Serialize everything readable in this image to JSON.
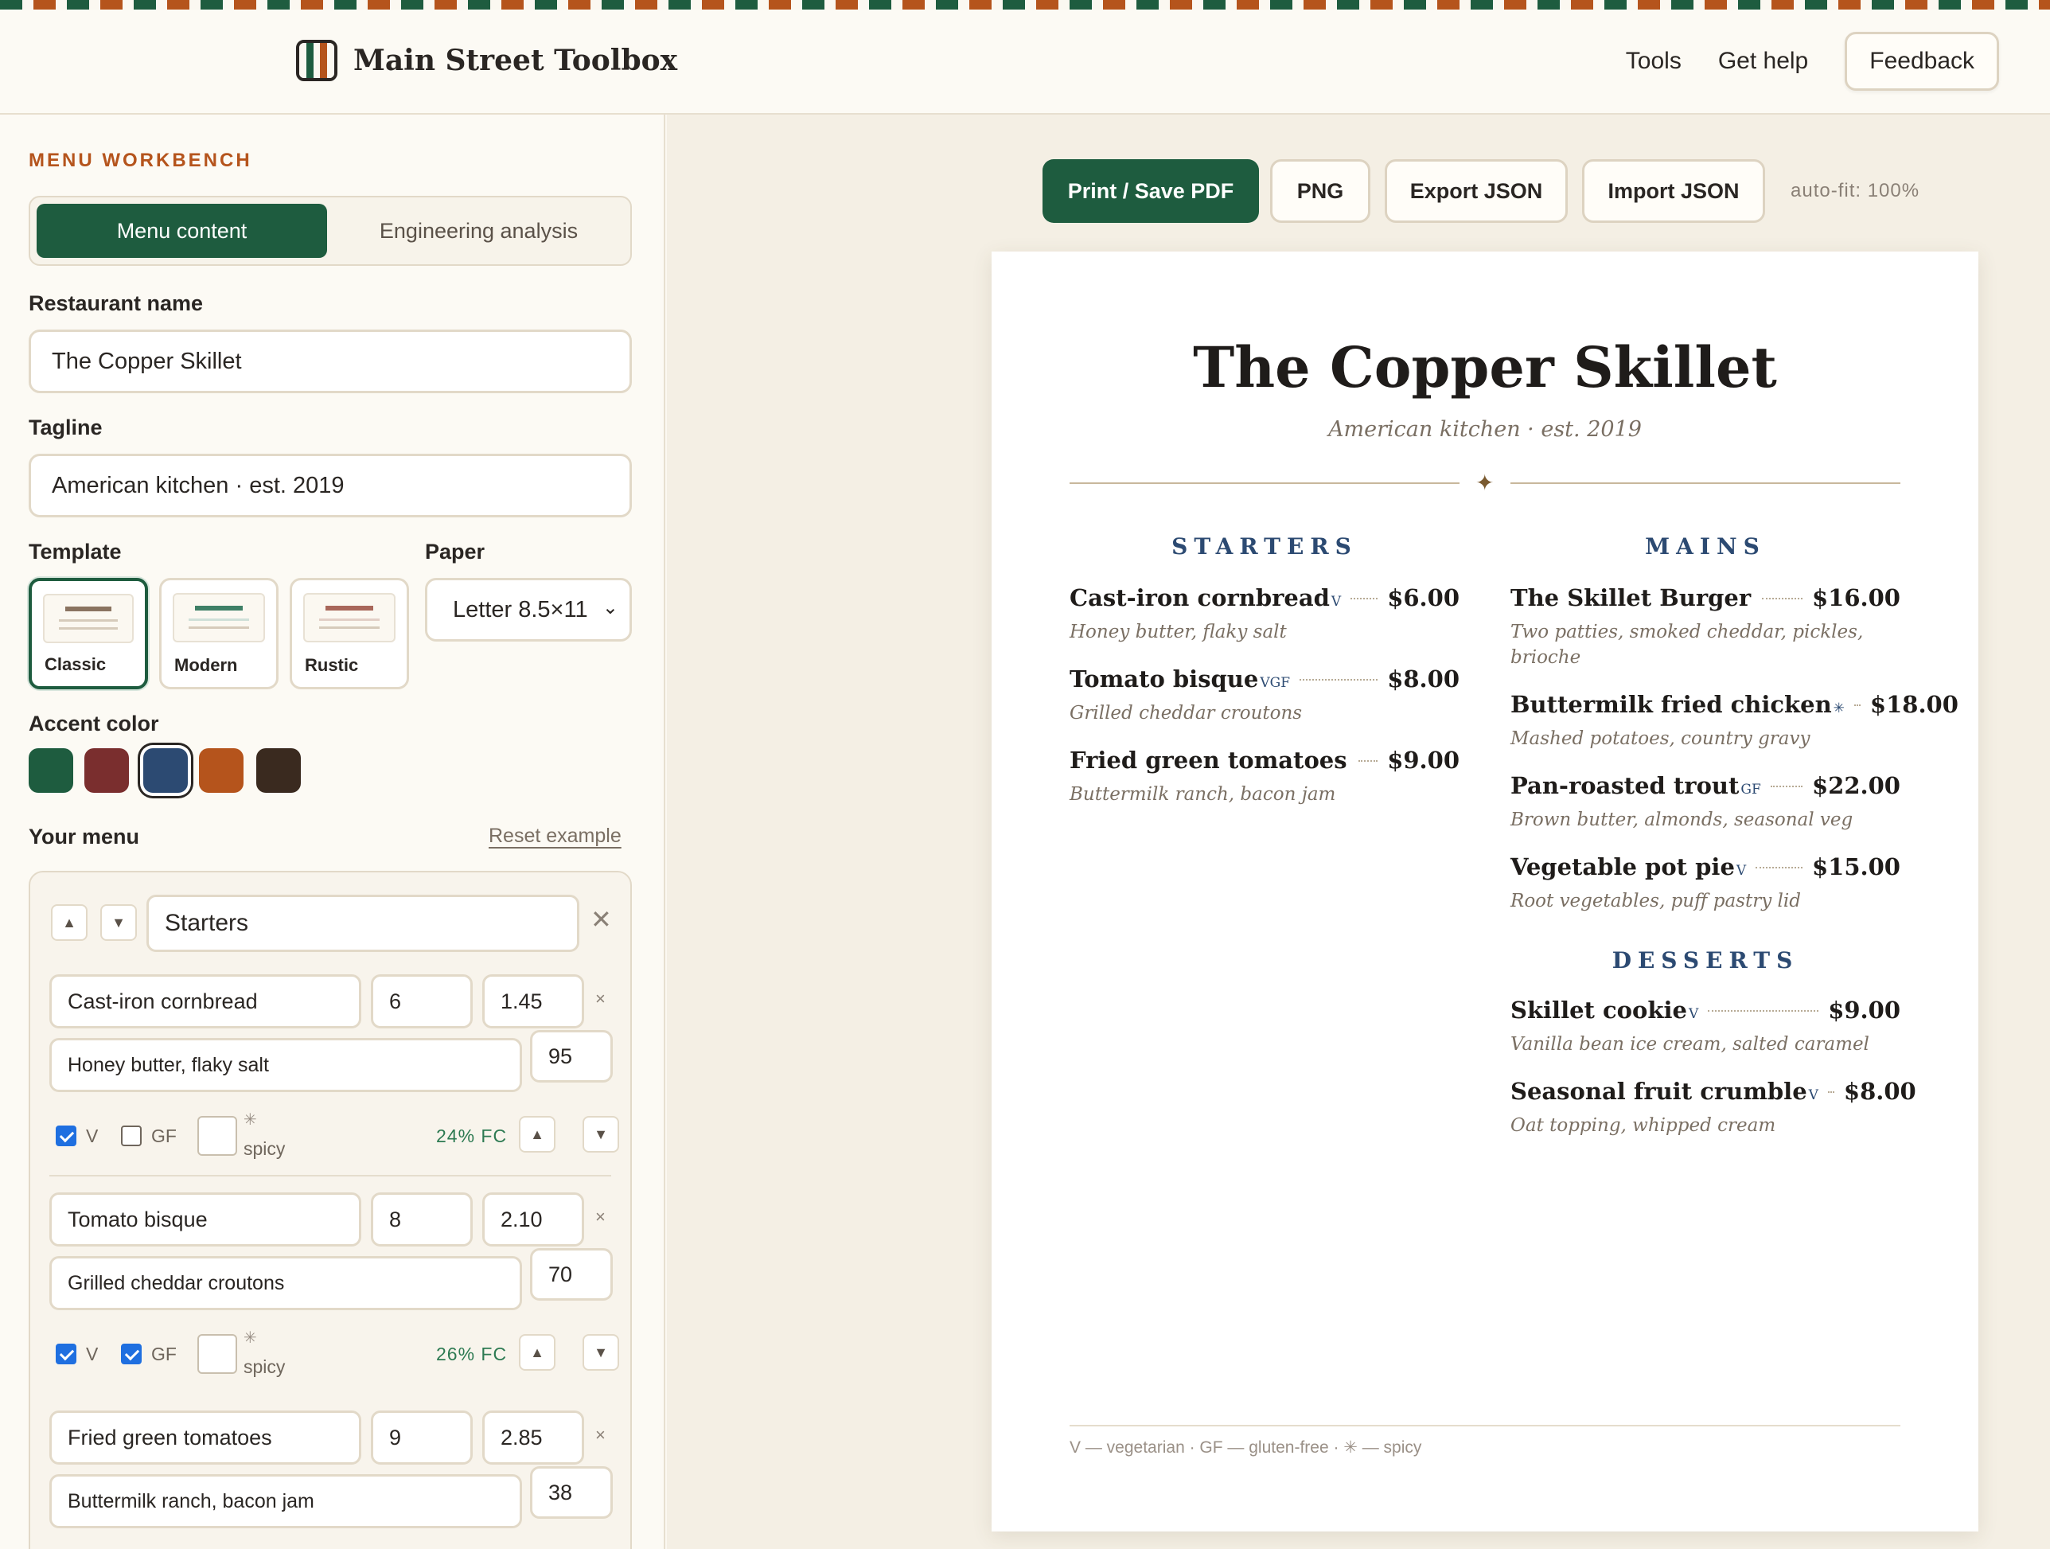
{
  "header": {
    "brand": "Main Street Toolbox",
    "nav": [
      "Tools",
      "Get help"
    ],
    "feedback": "Feedback"
  },
  "panel": {
    "eyebrow": "MENU WORKBENCH",
    "tabs": [
      "Menu content",
      "Engineering analysis"
    ],
    "restaurant_label": "Restaurant name",
    "restaurant_value": "The Copper Skillet",
    "tagline_label": "Tagline",
    "tagline_value": "American kitchen · est. 2019",
    "template_label": "Template",
    "templates": [
      "Classic",
      "Modern",
      "Rustic"
    ],
    "template_selected": "Classic",
    "paper_label": "Paper",
    "paper_value": "Letter 8.5×11",
    "accent_label": "Accent color",
    "accent_colors": [
      "#1e5c3f",
      "#7a2e2e",
      "#2c4a72",
      "#b5541c",
      "#3a2a1f"
    ],
    "accent_selected": "#2c4a72",
    "your_menu_label": "Your menu",
    "reset_label": "Reset example",
    "section_name": "Starters",
    "checkbox_v": "V",
    "checkbox_gf": "GF",
    "spicy_label": "spicy",
    "spicy_symbol": "✳",
    "items": [
      {
        "name": "Cast-iron cornbread",
        "price": "6",
        "cost": "1.45",
        "desc": "Honey butter, flaky salt",
        "qty": "95",
        "v": true,
        "gf": false,
        "fc": "24% FC"
      },
      {
        "name": "Tomato bisque",
        "price": "8",
        "cost": "2.10",
        "desc": "Grilled cheddar croutons",
        "qty": "70",
        "v": true,
        "gf": true,
        "fc": "26% FC"
      },
      {
        "name": "Fried green tomatoes",
        "price": "9",
        "cost": "2.85",
        "desc": "Buttermilk ranch, bacon jam",
        "qty": "38"
      }
    ]
  },
  "toolbar": {
    "print": "Print / Save PDF",
    "png": "PNG",
    "export": "Export JSON",
    "import": "Import JSON",
    "autofit": "auto-fit: 100%"
  },
  "menu": {
    "title": "The Copper Skillet",
    "tagline": "American kitchen · est. 2019",
    "ornament": "✦",
    "starters": {
      "heading": "STARTERS",
      "items": [
        {
          "name": "Cast-iron cornbread",
          "tags": "V",
          "price": "$6.00",
          "desc": "Honey butter, flaky salt"
        },
        {
          "name": "Tomato bisque",
          "tags": "VGF",
          "price": "$8.00",
          "desc": "Grilled cheddar croutons"
        },
        {
          "name": "Fried green tomatoes",
          "tags": "",
          "price": "$9.00",
          "desc": "Buttermilk ranch, bacon jam"
        }
      ]
    },
    "mains": {
      "heading": "MAINS",
      "items": [
        {
          "name": "The Skillet Burger",
          "tags": "",
          "price": "$16.00",
          "desc": "Two patties, smoked cheddar, pickles, brioche"
        },
        {
          "name": "Buttermilk fried chicken",
          "tags": "✳",
          "price": "$18.00",
          "desc": "Mashed potatoes, country gravy"
        },
        {
          "name": "Pan-roasted trout",
          "tags": "GF",
          "price": "$22.00",
          "desc": "Brown butter, almonds, seasonal veg"
        },
        {
          "name": "Vegetable pot pie",
          "tags": "V",
          "price": "$15.00",
          "desc": "Root vegetables, puff pastry lid"
        }
      ]
    },
    "desserts": {
      "heading": "DESSERTS",
      "items": [
        {
          "name": "Skillet cookie",
          "tags": "V",
          "price": "$9.00",
          "desc": "Vanilla bean ice cream, salted caramel"
        },
        {
          "name": "Seasonal fruit crumble",
          "tags": "V",
          "price": "$8.00",
          "desc": "Oat topping, whipped cream"
        }
      ]
    },
    "legend": "V — vegetarian · GF — gluten-free · ✳ — spicy"
  }
}
